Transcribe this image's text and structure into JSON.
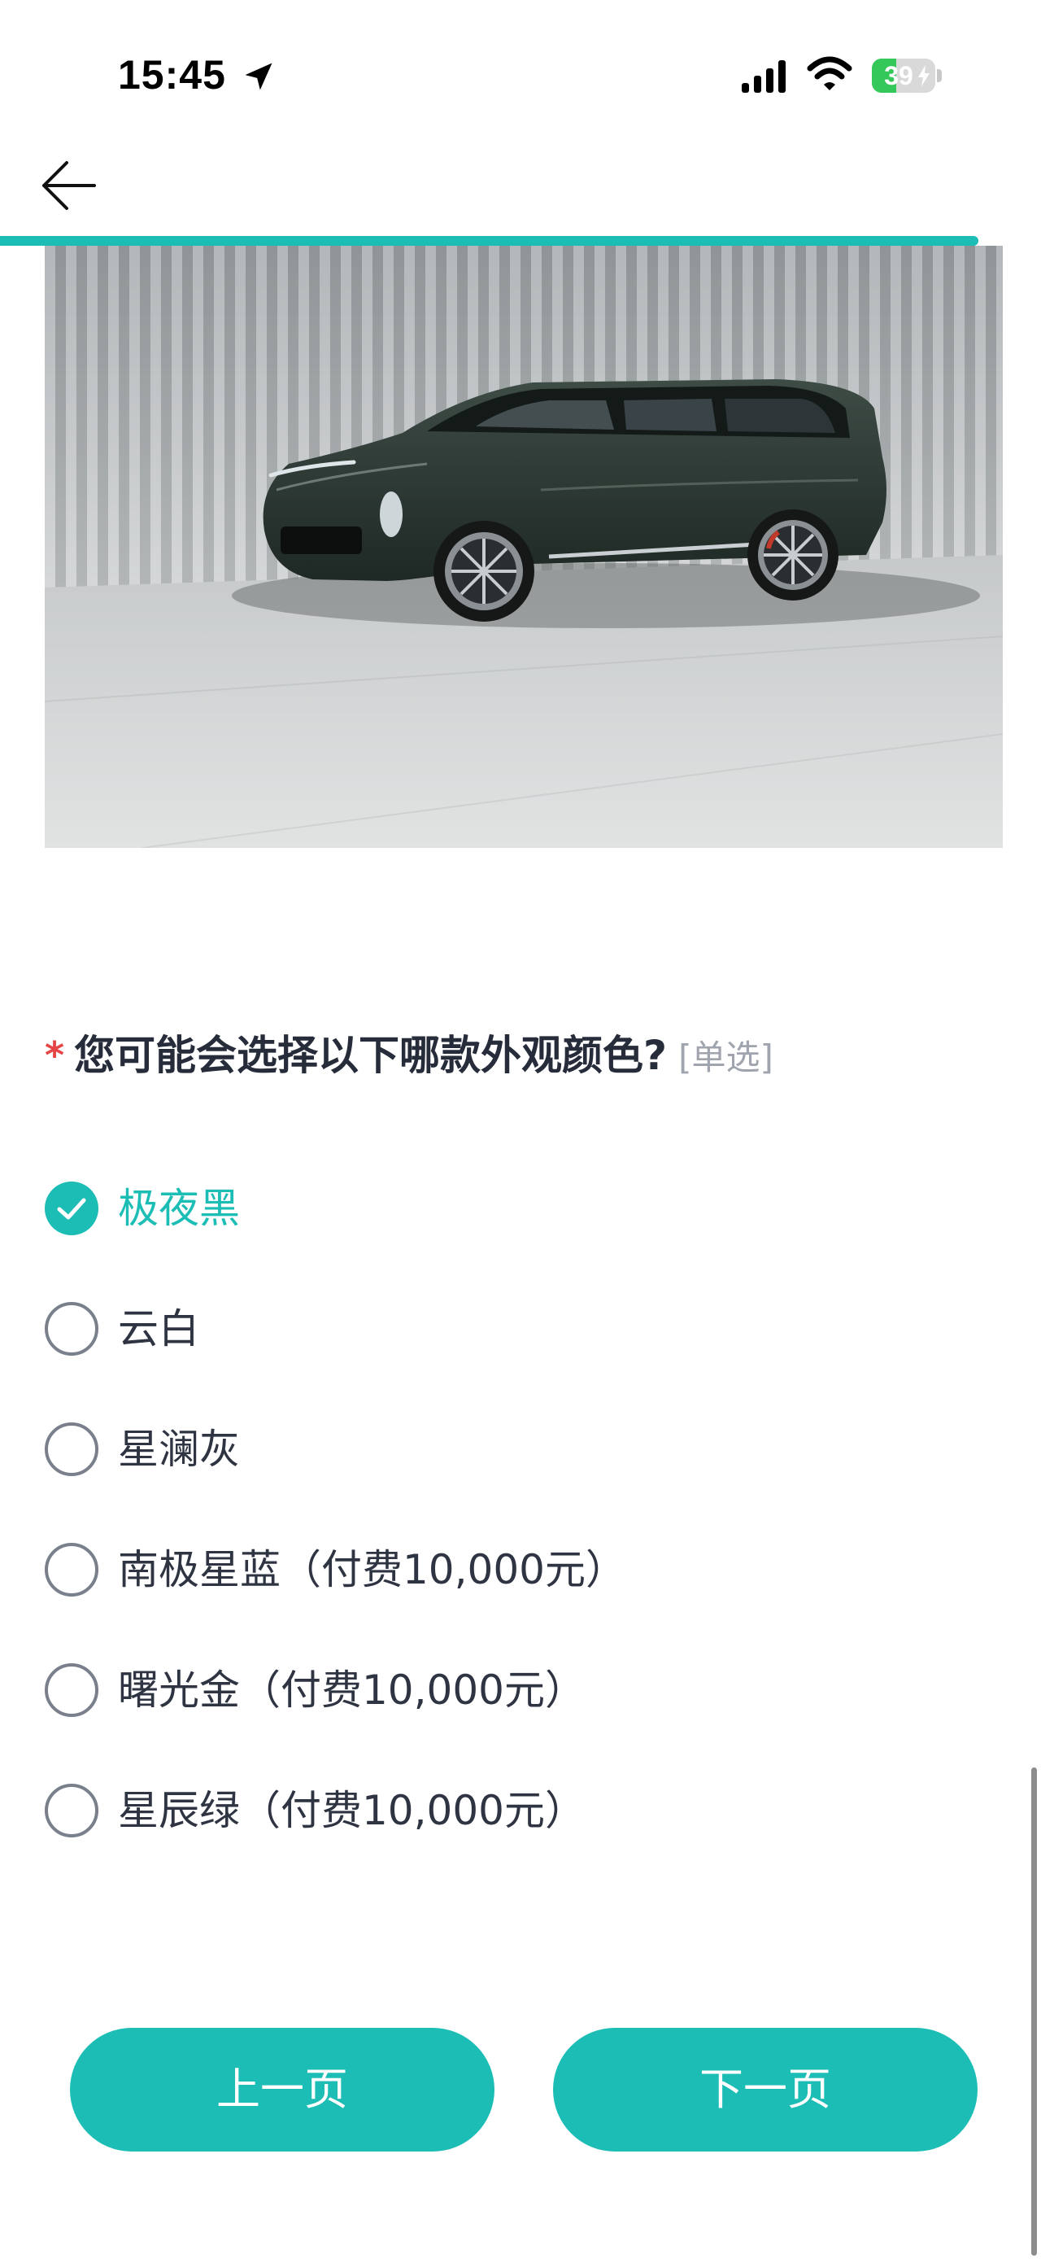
{
  "status_bar": {
    "time": "15:45",
    "battery_percent": "39",
    "battery_level": 0.39,
    "location_icon": "location-arrow-icon",
    "signal_icon": "cellular-signal-icon",
    "wifi_icon": "wifi-icon",
    "battery_icon": "battery-charging-icon"
  },
  "nav": {
    "back_icon": "arrow-left-icon",
    "progress": 0.94
  },
  "hero_image": {
    "subject": "dark green SUV in studio"
  },
  "question": {
    "required_mark": "*",
    "text": "您可能会选择以下哪款外观颜色?",
    "type_tag": "[单选]"
  },
  "options": [
    {
      "label": "极夜黑",
      "selected": true
    },
    {
      "label": "云白",
      "selected": false
    },
    {
      "label": "星澜灰",
      "selected": false
    },
    {
      "label": "南极星蓝（付费10,000元）",
      "selected": false
    },
    {
      "label": "曙光金（付费10,000元）",
      "selected": false
    },
    {
      "label": "星辰绿（付费10,000元）",
      "selected": false
    }
  ],
  "buttons": {
    "prev_label": "上一页",
    "next_label": "下一页"
  },
  "colors": {
    "accent": "#1bbdb5",
    "required": "#e54545",
    "text": "#2f3442",
    "muted": "#a0a4ae"
  }
}
